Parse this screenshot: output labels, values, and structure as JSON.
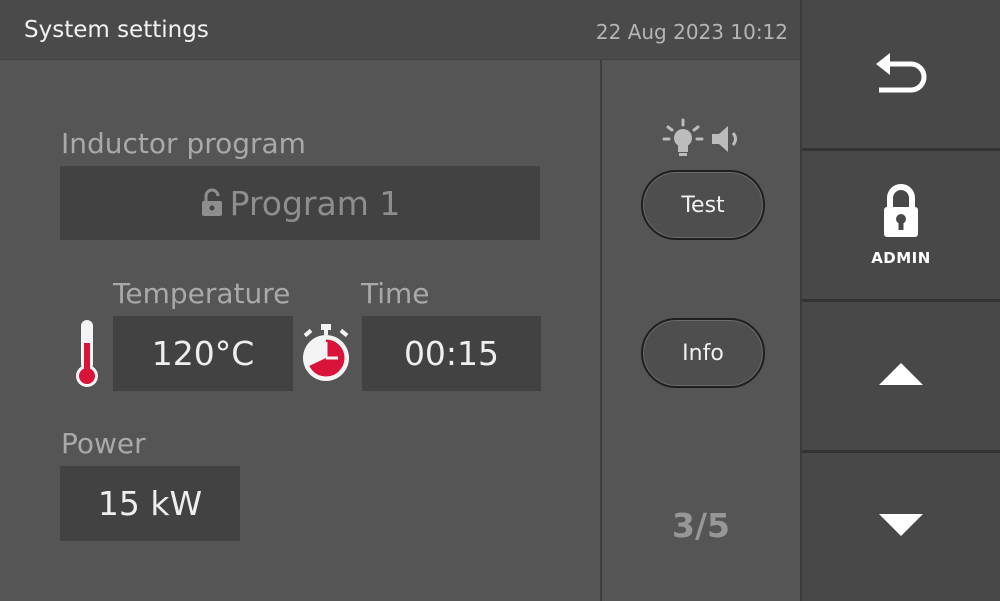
{
  "header": {
    "title": "System settings",
    "datetime": "22 Aug 2023 10:12"
  },
  "inductor": {
    "label": "Inductor program",
    "value": "Program 1",
    "locked": true
  },
  "temperature": {
    "label": "Temperature",
    "value": "120°C"
  },
  "time": {
    "label": "Time",
    "value": "00:15"
  },
  "power": {
    "label": "Power",
    "value": "15 kW"
  },
  "middle": {
    "test_label": "Test",
    "info_label": "Info",
    "page_indicator": "3/5"
  },
  "sidebar": {
    "admin_label": "ADMIN"
  },
  "colors": {
    "accent": "#d9143a",
    "background": "#555555",
    "field": "#424242",
    "sidebar_button": "#484848"
  },
  "icons": {
    "back": "back-arrow-icon",
    "lock": "lock-icon",
    "thermometer": "thermometer-icon",
    "timer": "stopwatch-icon",
    "light": "light-bulb-icon",
    "sound": "speaker-icon",
    "up": "up-arrow-icon",
    "down": "down-arrow-icon"
  }
}
